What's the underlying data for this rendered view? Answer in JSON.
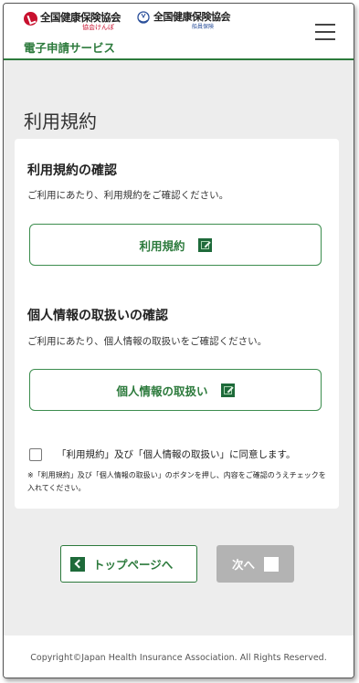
{
  "header": {
    "org_name": "全国健康保険協会",
    "org_sub": "協会けんぽ",
    "org2_name": "全国健康保険協会",
    "org2_sub": "船員保険",
    "service_name": "電子申請サービス",
    "menu_icon": "hamburger-menu-icon"
  },
  "page": {
    "title": "利用規約"
  },
  "terms_section": {
    "title": "利用規約の確認",
    "description": "ご利用にあたり、利用規約をご確認ください。",
    "button_label": "利用規約",
    "button_icon": "external-link-icon"
  },
  "privacy_section": {
    "title": "個人情報の取扱いの確認",
    "description": "ご利用にあたり、個人情報の取扱いをご確認ください。",
    "button_label": "個人情報の取扱い",
    "button_icon": "external-link-icon"
  },
  "agreement": {
    "label": "「利用規約」及び「個人情報の取扱い」に同意します。",
    "checked": false,
    "note": "※「利用規約」及び「個人情報の取扱い」のボタンを押し、内容をご確認のうえチェックを入れてください。"
  },
  "navigation": {
    "top_label": "トップページへ",
    "top_icon": "chevron-left-icon",
    "next_label": "次へ",
    "next_icon": "square-icon",
    "next_disabled": true
  },
  "footer": {
    "copyright": "Copyright©Japan Health Insurance Association. All Rights Reserved."
  },
  "colors": {
    "brand_green": "#2c7a3c",
    "brand_red": "#c8102e",
    "disabled_gray": "#b3b3b3",
    "background": "#ededed"
  }
}
